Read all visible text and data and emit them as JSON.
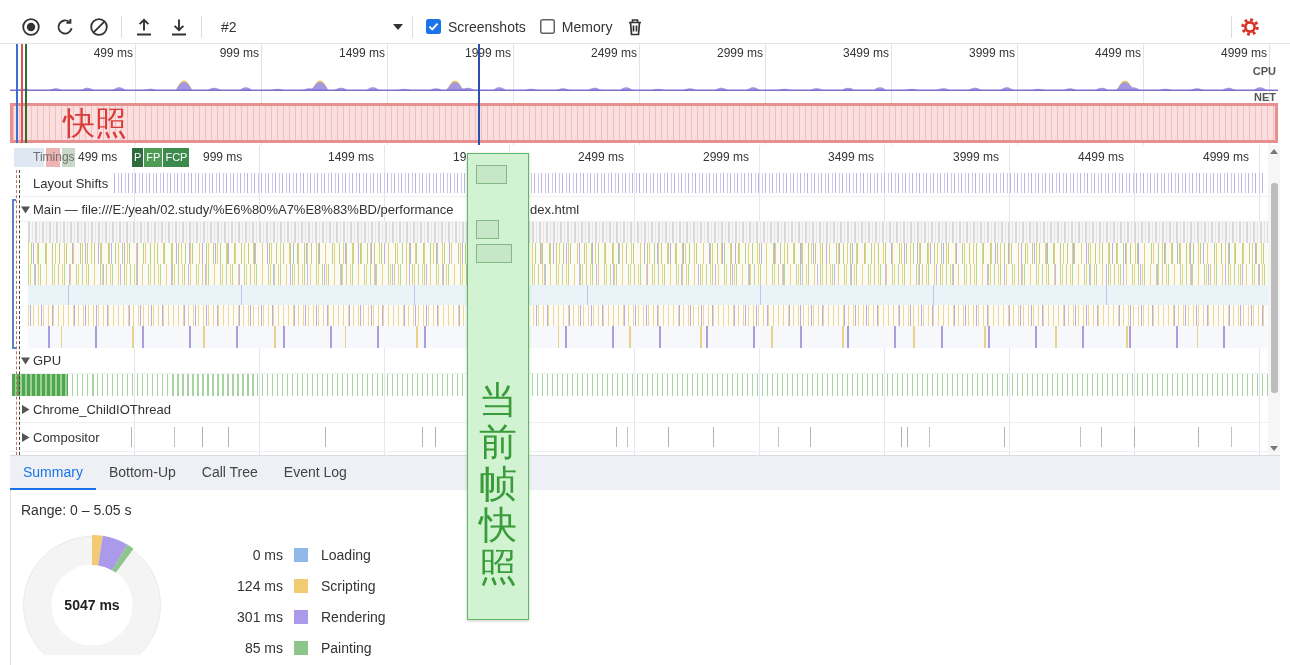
{
  "toolbar": {
    "recording": "#2",
    "checkboxes": [
      {
        "label": "Screenshots",
        "checked": true
      },
      {
        "label": "Memory",
        "checked": false
      }
    ]
  },
  "overview": {
    "ticks": [
      "499 ms",
      "999 ms",
      "1499 ms",
      "1999 ms",
      "2499 ms",
      "2999 ms",
      "3499 ms",
      "3999 ms",
      "4499 ms",
      "4999 ms"
    ],
    "tracks": [
      "CPU",
      "NET"
    ],
    "screenshots_note": "快照"
  },
  "flame_chart": {
    "ticks": [
      "499 ms",
      "999 ms",
      "1499 ms",
      "19",
      "2499 ms",
      "2999 ms",
      "3499 ms",
      "3999 ms",
      "4499 ms",
      "4999 ms"
    ],
    "timings": {
      "label": "Timings",
      "markers": [
        {
          "color": "#dfe7f2"
        },
        {
          "color": "#eeb4b4"
        },
        {
          "color": "#c9d8c9"
        },
        {
          "label": "P",
          "color": "#2f6b3d"
        },
        {
          "label": "FP",
          "color": "#4f9a55"
        },
        {
          "label": "FCP",
          "color": "#3d8a4d"
        }
      ]
    },
    "tracks": [
      {
        "kind": "shifts",
        "label": "Layout Shifts"
      },
      {
        "kind": "main",
        "label": "Main — file:///E:/yeah/02.study/%E6%80%A7%E8%83%BD/performance",
        "label_tail": "dex.html",
        "expanded": true
      },
      {
        "kind": "gpu",
        "label": "GPU",
        "expanded": true
      },
      {
        "kind": "io",
        "label": "Chrome_ChildIOThread",
        "expanded": false
      },
      {
        "kind": "compositor",
        "label": "Compositor",
        "expanded": false
      }
    ]
  },
  "details": {
    "tabs": [
      {
        "label": "Summary",
        "selected": true
      },
      {
        "label": "Bottom-Up",
        "selected": false
      },
      {
        "label": "Call Tree",
        "selected": false
      },
      {
        "label": "Event Log",
        "selected": false
      }
    ],
    "summary": {
      "range": "Range: 0 – 5.05 s",
      "total": "5047 ms",
      "legend": [
        {
          "value": "0 ms",
          "label": "Loading",
          "color": "#8fb8e9"
        },
        {
          "value": "124 ms",
          "label": "Scripting",
          "color": "#f0cb72"
        },
        {
          "value": "301 ms",
          "label": "Rendering",
          "color": "#ab9aea"
        },
        {
          "value": "85 ms",
          "label": "Painting",
          "color": "#8ec58a"
        }
      ]
    }
  },
  "frame_callout": {
    "text": "当前帧快照"
  }
}
